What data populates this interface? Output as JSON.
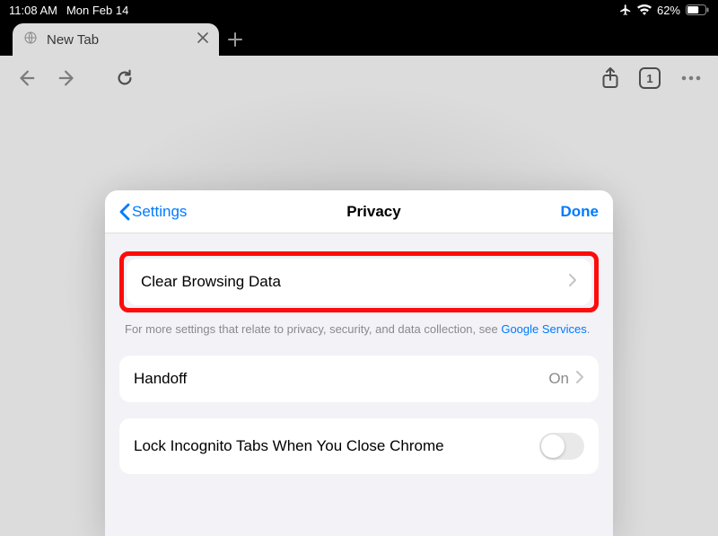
{
  "status": {
    "time": "11:08 AM",
    "date": "Mon Feb 14",
    "battery_pct": "62%"
  },
  "tab": {
    "title": "New Tab"
  },
  "toolbar": {
    "tab_count": "1"
  },
  "sheet": {
    "back_label": "Settings",
    "title": "Privacy",
    "done_label": "Done",
    "clear_browsing_label": "Clear Browsing Data",
    "footer_prefix": "For more settings that relate to privacy, security, and data collection, see ",
    "footer_link_text": "Google Services",
    "footer_suffix": ".",
    "handoff_label": "Handoff",
    "handoff_value": "On",
    "lock_incognito_label": "Lock Incognito Tabs When You Close Chrome"
  }
}
